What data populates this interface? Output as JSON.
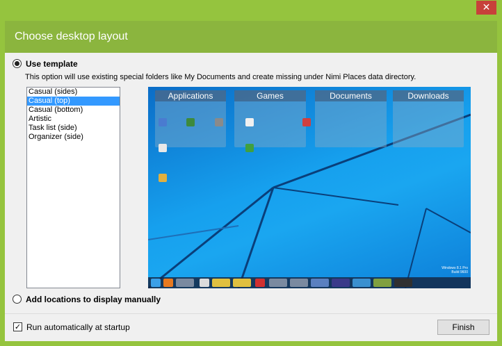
{
  "window": {
    "close_glyph": "✕"
  },
  "header": {
    "title": "Choose desktop layout"
  },
  "option_template": {
    "label": "Use template",
    "description": "This option will use existing special folders like My Documents and create missing under Nimi Places data directory.",
    "selected": true
  },
  "layouts": {
    "items": [
      "Casual (sides)",
      "Casual (top)",
      "Casual (bottom)",
      "Artistic",
      "Task list (side)",
      "Organizer (side)"
    ],
    "selected_index": 1
  },
  "preview": {
    "groups": [
      "Applications",
      "Games",
      "Documents",
      "Downloads"
    ],
    "windows_info": [
      "Windows 8.1 Pro",
      "Build 9600"
    ]
  },
  "option_manual": {
    "label": "Add locations to display manually",
    "selected": false
  },
  "startup": {
    "label": "Run automatically at startup",
    "checked": true
  },
  "finish_label": "Finish"
}
